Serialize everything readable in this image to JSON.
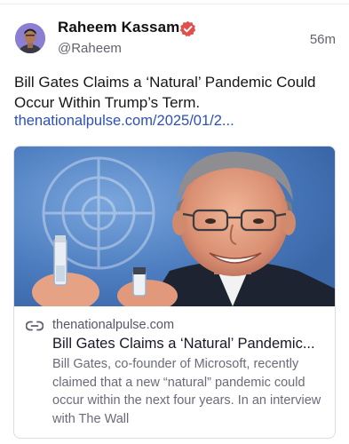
{
  "post": {
    "author_name": "Raheem Kassam",
    "handle": "@Raheem",
    "time_ago": "56m",
    "text": "Bill Gates Claims a ‘Natural’ Pandemic Could Occur Within Trump’s Term.",
    "link_text": "thenationalpulse.com/2025/01/2..."
  },
  "link_card": {
    "domain": "thenationalpulse.com",
    "title": "Bill Gates Claims a ‘Natural’ Pandemic...",
    "description": "Bill Gates, co-founder of Microsoft, recently claimed that a new “natural” pandemic could occur within the next four years. In an interview with The Wall"
  },
  "icons": {
    "verified": "verified-badge-icon",
    "link": "link-icon"
  },
  "colors": {
    "accent_link": "#2e50b5",
    "verified_badge": "#e0514d",
    "muted_text": "#62636e"
  }
}
